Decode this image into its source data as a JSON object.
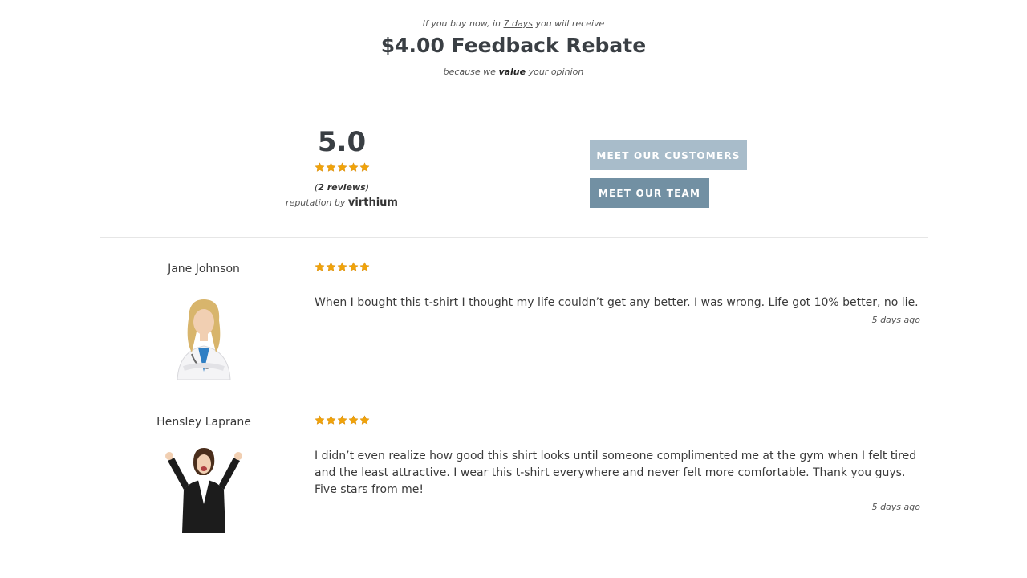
{
  "rebate": {
    "intro_before": "If you buy now, in ",
    "intro_days": "7 days",
    "intro_after": " you will receive",
    "title": "$4.00 Feedback Rebate",
    "sub_before": "because we ",
    "sub_bold": "value",
    "sub_after": " your opinion"
  },
  "rating": {
    "score": "5.0",
    "stars": 5,
    "count_open": "(",
    "count_text": "2 reviews",
    "count_close": ")",
    "reputation_prefix": "reputation by ",
    "brand": "virthium"
  },
  "buttons": {
    "customers_label": "MEET OUR CUSTOMERS",
    "team_label": "MEET OUR TEAM"
  },
  "colors": {
    "star": "#f0a30a",
    "button_light": "#a8bcca",
    "button_dark": "#7290a3"
  },
  "reviews": [
    {
      "name": "Jane Johnson",
      "stars": 5,
      "text": "When I bought this t-shirt I thought my life couldn’t get any better. I was wrong. Life got 10% better, no lie.",
      "date": "5 days ago"
    },
    {
      "name": "Hensley Laprane",
      "stars": 5,
      "text": "I didn’t even realize how good this shirt looks until someone complimented me at the gym when I felt tired and the least attractive. I wear this t-shirt everywhere and never felt more comfortable. Thank you guys. Five stars from me!",
      "date": "5 days ago"
    }
  ]
}
